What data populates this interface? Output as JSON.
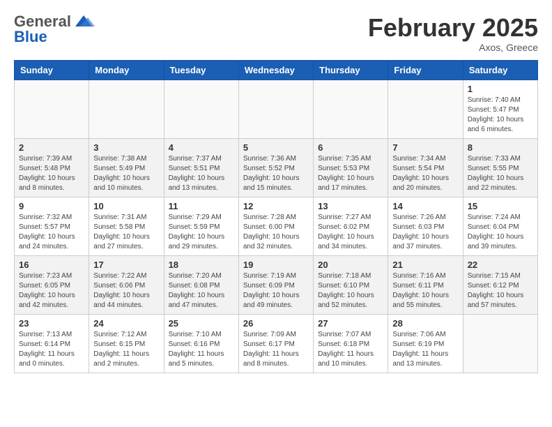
{
  "header": {
    "logo_general": "General",
    "logo_blue": "Blue",
    "month_year": "February 2025",
    "location": "Axos, Greece"
  },
  "weekdays": [
    "Sunday",
    "Monday",
    "Tuesday",
    "Wednesday",
    "Thursday",
    "Friday",
    "Saturday"
  ],
  "weeks": [
    {
      "shaded": false,
      "days": [
        {
          "num": "",
          "info": ""
        },
        {
          "num": "",
          "info": ""
        },
        {
          "num": "",
          "info": ""
        },
        {
          "num": "",
          "info": ""
        },
        {
          "num": "",
          "info": ""
        },
        {
          "num": "",
          "info": ""
        },
        {
          "num": "1",
          "info": "Sunrise: 7:40 AM\nSunset: 5:47 PM\nDaylight: 10 hours and 6 minutes."
        }
      ]
    },
    {
      "shaded": true,
      "days": [
        {
          "num": "2",
          "info": "Sunrise: 7:39 AM\nSunset: 5:48 PM\nDaylight: 10 hours and 8 minutes."
        },
        {
          "num": "3",
          "info": "Sunrise: 7:38 AM\nSunset: 5:49 PM\nDaylight: 10 hours and 10 minutes."
        },
        {
          "num": "4",
          "info": "Sunrise: 7:37 AM\nSunset: 5:51 PM\nDaylight: 10 hours and 13 minutes."
        },
        {
          "num": "5",
          "info": "Sunrise: 7:36 AM\nSunset: 5:52 PM\nDaylight: 10 hours and 15 minutes."
        },
        {
          "num": "6",
          "info": "Sunrise: 7:35 AM\nSunset: 5:53 PM\nDaylight: 10 hours and 17 minutes."
        },
        {
          "num": "7",
          "info": "Sunrise: 7:34 AM\nSunset: 5:54 PM\nDaylight: 10 hours and 20 minutes."
        },
        {
          "num": "8",
          "info": "Sunrise: 7:33 AM\nSunset: 5:55 PM\nDaylight: 10 hours and 22 minutes."
        }
      ]
    },
    {
      "shaded": false,
      "days": [
        {
          "num": "9",
          "info": "Sunrise: 7:32 AM\nSunset: 5:57 PM\nDaylight: 10 hours and 24 minutes."
        },
        {
          "num": "10",
          "info": "Sunrise: 7:31 AM\nSunset: 5:58 PM\nDaylight: 10 hours and 27 minutes."
        },
        {
          "num": "11",
          "info": "Sunrise: 7:29 AM\nSunset: 5:59 PM\nDaylight: 10 hours and 29 minutes."
        },
        {
          "num": "12",
          "info": "Sunrise: 7:28 AM\nSunset: 6:00 PM\nDaylight: 10 hours and 32 minutes."
        },
        {
          "num": "13",
          "info": "Sunrise: 7:27 AM\nSunset: 6:02 PM\nDaylight: 10 hours and 34 minutes."
        },
        {
          "num": "14",
          "info": "Sunrise: 7:26 AM\nSunset: 6:03 PM\nDaylight: 10 hours and 37 minutes."
        },
        {
          "num": "15",
          "info": "Sunrise: 7:24 AM\nSunset: 6:04 PM\nDaylight: 10 hours and 39 minutes."
        }
      ]
    },
    {
      "shaded": true,
      "days": [
        {
          "num": "16",
          "info": "Sunrise: 7:23 AM\nSunset: 6:05 PM\nDaylight: 10 hours and 42 minutes."
        },
        {
          "num": "17",
          "info": "Sunrise: 7:22 AM\nSunset: 6:06 PM\nDaylight: 10 hours and 44 minutes."
        },
        {
          "num": "18",
          "info": "Sunrise: 7:20 AM\nSunset: 6:08 PM\nDaylight: 10 hours and 47 minutes."
        },
        {
          "num": "19",
          "info": "Sunrise: 7:19 AM\nSunset: 6:09 PM\nDaylight: 10 hours and 49 minutes."
        },
        {
          "num": "20",
          "info": "Sunrise: 7:18 AM\nSunset: 6:10 PM\nDaylight: 10 hours and 52 minutes."
        },
        {
          "num": "21",
          "info": "Sunrise: 7:16 AM\nSunset: 6:11 PM\nDaylight: 10 hours and 55 minutes."
        },
        {
          "num": "22",
          "info": "Sunrise: 7:15 AM\nSunset: 6:12 PM\nDaylight: 10 hours and 57 minutes."
        }
      ]
    },
    {
      "shaded": false,
      "days": [
        {
          "num": "23",
          "info": "Sunrise: 7:13 AM\nSunset: 6:14 PM\nDaylight: 11 hours and 0 minutes."
        },
        {
          "num": "24",
          "info": "Sunrise: 7:12 AM\nSunset: 6:15 PM\nDaylight: 11 hours and 2 minutes."
        },
        {
          "num": "25",
          "info": "Sunrise: 7:10 AM\nSunset: 6:16 PM\nDaylight: 11 hours and 5 minutes."
        },
        {
          "num": "26",
          "info": "Sunrise: 7:09 AM\nSunset: 6:17 PM\nDaylight: 11 hours and 8 minutes."
        },
        {
          "num": "27",
          "info": "Sunrise: 7:07 AM\nSunset: 6:18 PM\nDaylight: 11 hours and 10 minutes."
        },
        {
          "num": "28",
          "info": "Sunrise: 7:06 AM\nSunset: 6:19 PM\nDaylight: 11 hours and 13 minutes."
        },
        {
          "num": "",
          "info": ""
        }
      ]
    }
  ]
}
